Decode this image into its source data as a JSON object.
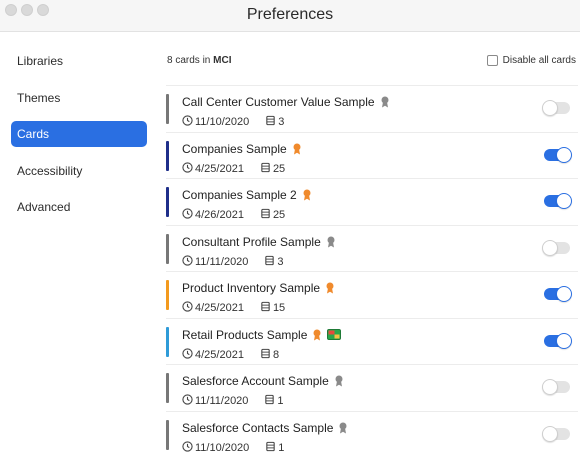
{
  "window": {
    "title": "Preferences"
  },
  "sidebar": {
    "items": [
      {
        "label": "Libraries",
        "selected": false
      },
      {
        "label": "Themes",
        "selected": false
      },
      {
        "label": "Cards",
        "selected": true
      },
      {
        "label": "Accessibility",
        "selected": false
      },
      {
        "label": "Advanced",
        "selected": false
      }
    ]
  },
  "main": {
    "count_text": "8 cards in",
    "library_name": "MCI",
    "disable_all_label": "Disable all cards",
    "disable_all_checked": false,
    "cards": [
      {
        "name": "Call Center Customer Value Sample",
        "date": "11/10/2020",
        "count": "3",
        "color": "#777777",
        "ribbon": "gray",
        "flag": false,
        "enabled": false
      },
      {
        "name": "Companies Sample",
        "date": "4/25/2021",
        "count": "25",
        "color": "#1f2f8a",
        "ribbon": "orange",
        "flag": false,
        "enabled": true
      },
      {
        "name": "Companies Sample 2",
        "date": "4/26/2021",
        "count": "25",
        "color": "#1f2f8a",
        "ribbon": "orange",
        "flag": false,
        "enabled": true
      },
      {
        "name": "Consultant Profile Sample",
        "date": "11/11/2020",
        "count": "3",
        "color": "#777777",
        "ribbon": "gray",
        "flag": false,
        "enabled": false
      },
      {
        "name": "Product Inventory Sample",
        "date": "4/25/2021",
        "count": "15",
        "color": "#f39a1e",
        "ribbon": "orange",
        "flag": false,
        "enabled": true
      },
      {
        "name": "Retail Products Sample",
        "date": "4/25/2021",
        "count": "8",
        "color": "#2f9bd8",
        "ribbon": "orange",
        "flag": true,
        "enabled": true
      },
      {
        "name": "Salesforce Account Sample",
        "date": "11/11/2020",
        "count": "1",
        "color": "#777777",
        "ribbon": "gray",
        "flag": false,
        "enabled": false
      },
      {
        "name": "Salesforce Contacts Sample",
        "date": "11/10/2020",
        "count": "1",
        "color": "#777777",
        "ribbon": "gray",
        "flag": false,
        "enabled": false
      }
    ]
  },
  "colors": {
    "accent": "#2a6fe2",
    "ribbon_orange": "#f08a2c",
    "ribbon_gray": "#8a8a8a"
  },
  "icons": {
    "clock": "clock-icon",
    "cards": "cards-count-icon",
    "ribbon": "award-ribbon-icon",
    "flag": "flag-icon"
  }
}
